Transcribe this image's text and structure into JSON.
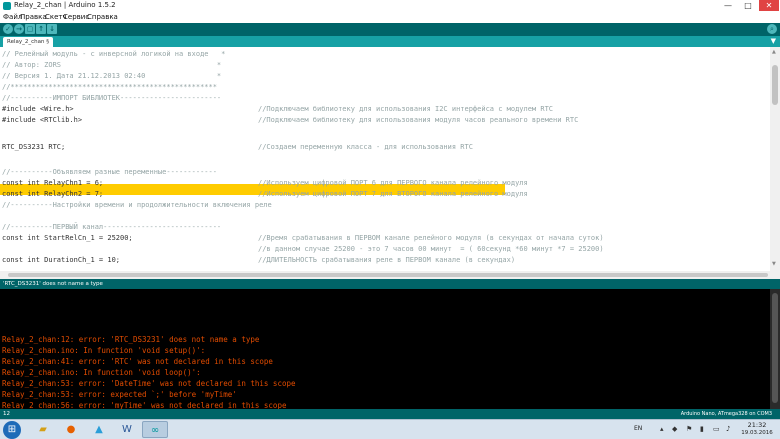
{
  "window": {
    "title": "Relay_2_chan | Arduino 1.5.2",
    "controls": {
      "minimize": "—",
      "maximize": "□",
      "close": "✕"
    }
  },
  "menu": [
    "Файл",
    "Правка",
    "Скетч",
    "Сервис",
    "Справка"
  ],
  "toolbar": {
    "verify": "✓",
    "upload": "→",
    "new": "▢",
    "open": "↑",
    "save": "↓",
    "serial_monitor": "⌕"
  },
  "tab": {
    "label": "Relay_2_chan §",
    "menu_icon": "▼"
  },
  "editor": {
    "lines": [
      {
        "code": "// Релейный модуль - с инверсной логикой на входе   *",
        "comment": ""
      },
      {
        "code": "// Автор: ZORS                                     *",
        "comment": ""
      },
      {
        "code": "// Версия 1. Дата 21.12.2013 02:40                 *",
        "comment": ""
      },
      {
        "code": "//*************************************************",
        "comment": ""
      },
      {
        "code": "//----------ИМПОРТ БИБЛИОТЕК------------------------",
        "comment": ""
      },
      {
        "code": "#include <Wire.h>",
        "comment": "//Подключаем библиотеку для использования I2C интерфейса с модулем RTC"
      },
      {
        "code": "#include <RTClib.h>",
        "comment": "//Подключаем библиотеку для использования модуля часов реального времени RTC"
      },
      {
        "code": "",
        "comment": ""
      },
      {
        "code": "RTC_DS3231 RTC;",
        "comment": "//Создаем переменную класса - для использования RTC"
      },
      {
        "code": "",
        "comment": ""
      },
      {
        "code": "//----------Объявляем разные переменные------------",
        "comment": ""
      },
      {
        "code": "const int RelayChn1 = 6;",
        "comment": "//Используем цифровой ПОРТ 6 для ПЕРВОГО канала релейного модуля"
      },
      {
        "code": "const int RelayChn2 = 7;",
        "comment": "//Используем цифровой ПОРТ 7 для ВТОРОГО канала релейного модуля"
      },
      {
        "code": "//----------Настройки времени и продолжительности включения реле",
        "comment": ""
      },
      {
        "code": "",
        "comment": ""
      },
      {
        "code": "//----------ПЕРВЫЙ канал----------------------------",
        "comment": ""
      },
      {
        "code": "const int StartRelCn_1 = 25200;",
        "comment": "//Время срабатывания в ПЕРВОМ канале релейного модуля (в секундах от начала суток)"
      },
      {
        "code": "",
        "comment": "//в данном случае 25200 - это 7 часов 00 минут  = ( 60секунд *60 минут *7 = 25200)"
      },
      {
        "code": "const int DurationCh_1 = 10;",
        "comment": "//ДЛИТЕЛЬНОСТЬ срабатывания реле в ПЕРВОМ канале (в секундах)"
      }
    ]
  },
  "status": {
    "message": "'RTC_DS3231' does not name a type"
  },
  "console": {
    "lines": [
      "",
      "",
      "",
      "",
      "Relay_2_chan:12: error: 'RTC_DS3231' does not name a type",
      "Relay_2_chan.ino: In function 'void setup()':",
      "Relay_2_chan:41: error: 'RTC' was not declared in this scope",
      "Relay_2_chan.ino: In function 'void loop()':",
      "Relay_2_chan:53: error: 'DateTime' was not declared in this scope",
      "Relay_2_chan:53: error: expected `;' before 'myTime'",
      "Relay_2_chan:56: error: 'myTime' was not declared in this scope"
    ]
  },
  "bottom": {
    "line_number": "12",
    "board": "Arduino Nano, ATmega328 on COM3"
  },
  "taskbar": {
    "language": "EN",
    "time": "21:32",
    "date": "19.03.2016"
  },
  "colors": {
    "accent": "#006468",
    "highlight": "#ffcc00",
    "error_text": "#e34c00"
  }
}
